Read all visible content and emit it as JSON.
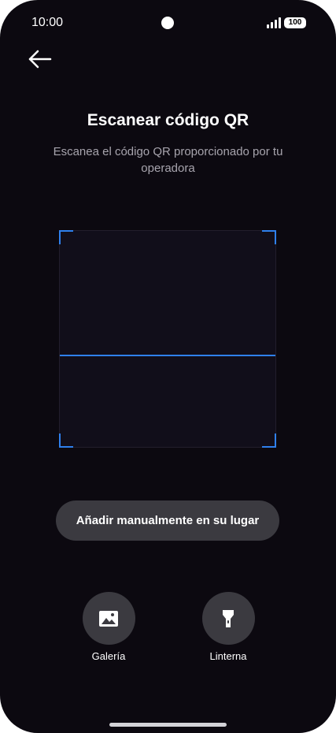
{
  "status_bar": {
    "time": "10:00",
    "battery": "100",
    "icons": [
      "camera-dot-icon",
      "signal-icon",
      "battery-icon"
    ]
  },
  "header": {
    "back_icon": "arrow-left-icon"
  },
  "main": {
    "title": "Escanear código QR",
    "subtitle": "Escanea el código QR proporcionado por tu operadora"
  },
  "manual_button": {
    "label": "Añadir manualmente en su lugar"
  },
  "actions": {
    "gallery": {
      "label": "Galería",
      "icon": "image-icon"
    },
    "flashlight": {
      "label": "Linterna",
      "icon": "flashlight-icon"
    }
  },
  "colors": {
    "background": "#0c0910",
    "accent": "#2f80ed",
    "button": "#3b3a40",
    "subtitle": "#a7a4ad"
  }
}
